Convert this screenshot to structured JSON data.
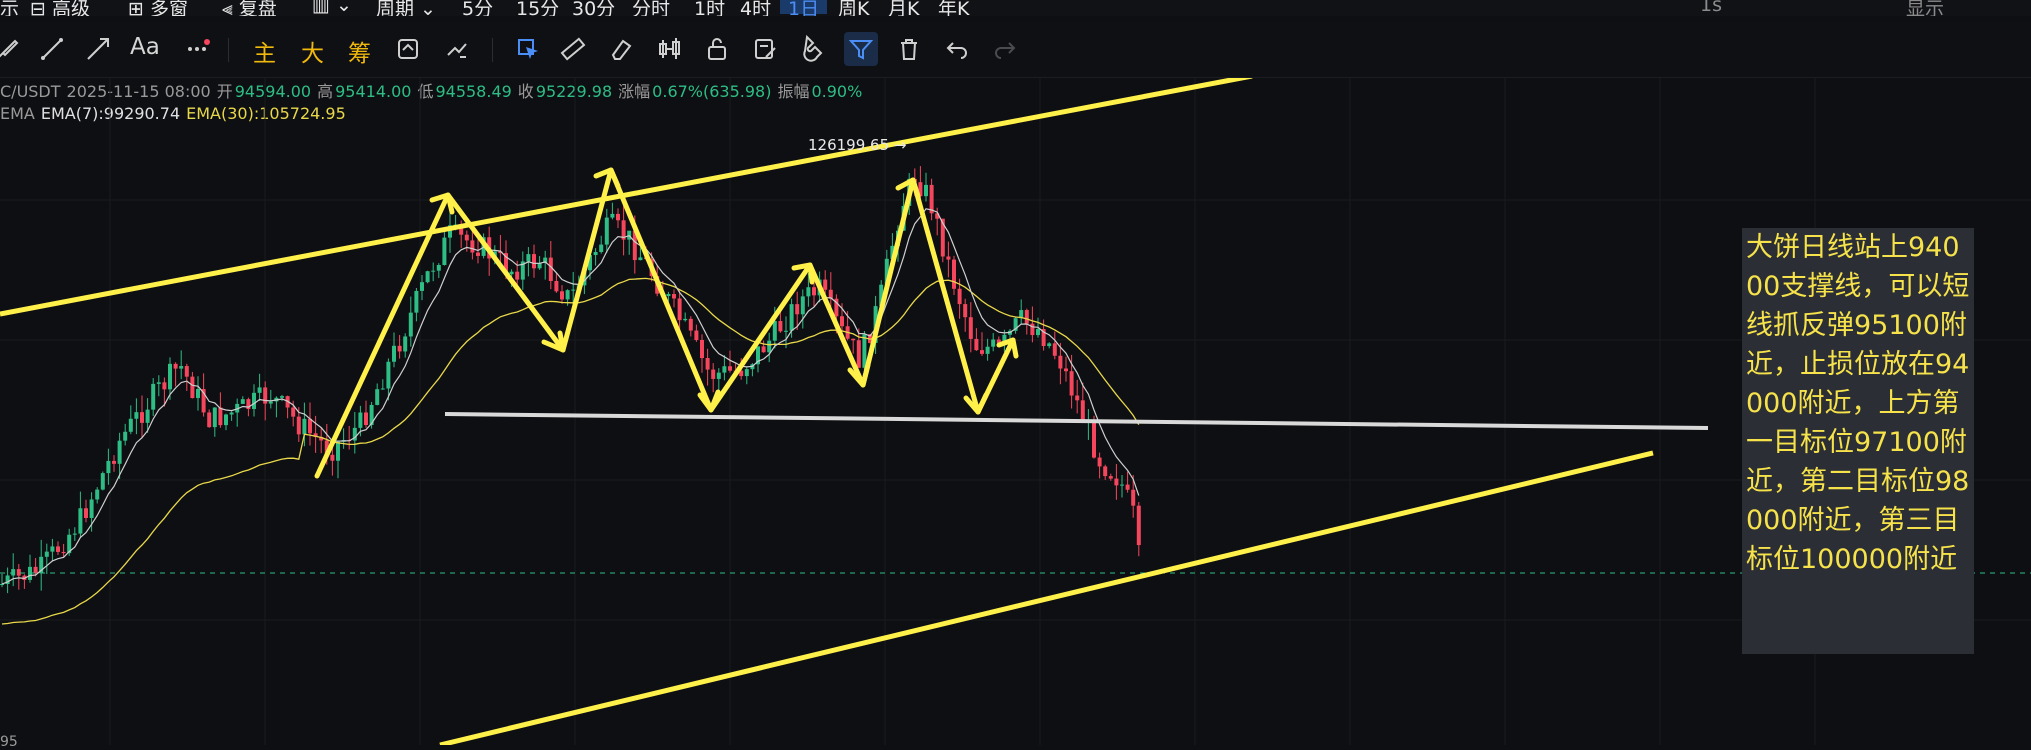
{
  "timeframes": [
    "示",
    "⊟ 高级",
    "⊞ 多窗",
    "⫷ 复盘",
    "▥ ⌄",
    "周期 ⌄",
    "5分",
    "15分",
    "30分",
    "分时",
    "1时",
    "4时",
    "1日",
    "周K",
    "月K",
    "年K"
  ],
  "active_timeframe": "1日",
  "top_right": [
    "1s",
    "显示"
  ],
  "toolbar": {
    "text_tool": "Aa",
    "btn_main": "主",
    "btn_big": "大",
    "btn_chips": "筹"
  },
  "ohlc": {
    "symbol": "C/USDT",
    "date": "2025-11-15 08:00",
    "open_label": "开",
    "open": "94594.00",
    "high_label": "高",
    "high": "95414.00",
    "low_label": "低",
    "low": "94558.49",
    "close_label": "收",
    "close": "95229.98",
    "change_label": "涨幅",
    "change": "0.67%(635.98)",
    "amp_label": "振幅",
    "amp": "0.90%"
  },
  "ema": {
    "label": "EMA",
    "ema7": "EMA(7):99290.74",
    "ema30": "EMA(30):105724.95"
  },
  "peak_label": "126199.65 →",
  "axis_bottom_left": "95",
  "note": "大饼日线站上94000支撑线，可以短线抓反弹95100附近，止损位放在94000附近，上方第一目标位97100附近，第二目标位98000附近，第三目标位100000附近",
  "colors": {
    "up": "#2ebd85",
    "down": "#f6465d",
    "trend": "#fff04a",
    "support": "#d9d9d9",
    "ema7": "#cfcfcf",
    "ema30": "#e8d84a",
    "accent": "#4b8ef5"
  },
  "icons": [
    "brush-icon",
    "line-icon",
    "ray-icon",
    "text-icon",
    "more-icon",
    "main-indicator",
    "big-indicator",
    "chips-indicator",
    "swap-icon",
    "measure-icon",
    "select-icon",
    "ruler-icon",
    "eraser-icon",
    "candle-icon",
    "unlock-icon",
    "note-icon",
    "magnet-icon",
    "filter-icon",
    "trash-icon",
    "undo-icon",
    "redo-icon"
  ]
}
